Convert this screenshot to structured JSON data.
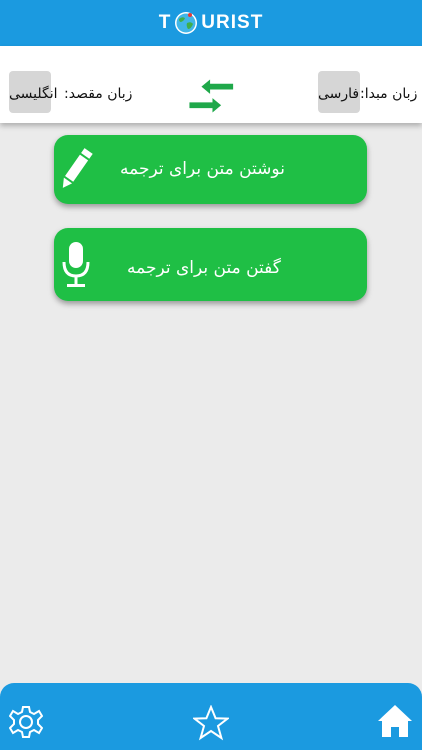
{
  "header": {
    "logo_prefix": "T",
    "logo_suffix": "URIST",
    "globe_icon": "globe-icon"
  },
  "languages": {
    "source_label": "زبان مبدا:",
    "source_value": "فارسی",
    "target_label": "زبان مقصد:",
    "target_value": "انگلیسی",
    "swap_icon": "swap-arrows-icon"
  },
  "actions": {
    "write": {
      "label": "نوشتن متن برای ترجمه",
      "icon": "pencil-icon"
    },
    "speak": {
      "label": "گفتن متن برای ترجمه",
      "icon": "microphone-icon"
    }
  },
  "bottom_nav": {
    "settings_icon": "gear-icon",
    "favorites_icon": "star-icon",
    "home_icon": "home-icon"
  },
  "colors": {
    "primary_blue": "#1b9ae0",
    "action_green": "#1fbf45",
    "background": "#ebebeb"
  }
}
